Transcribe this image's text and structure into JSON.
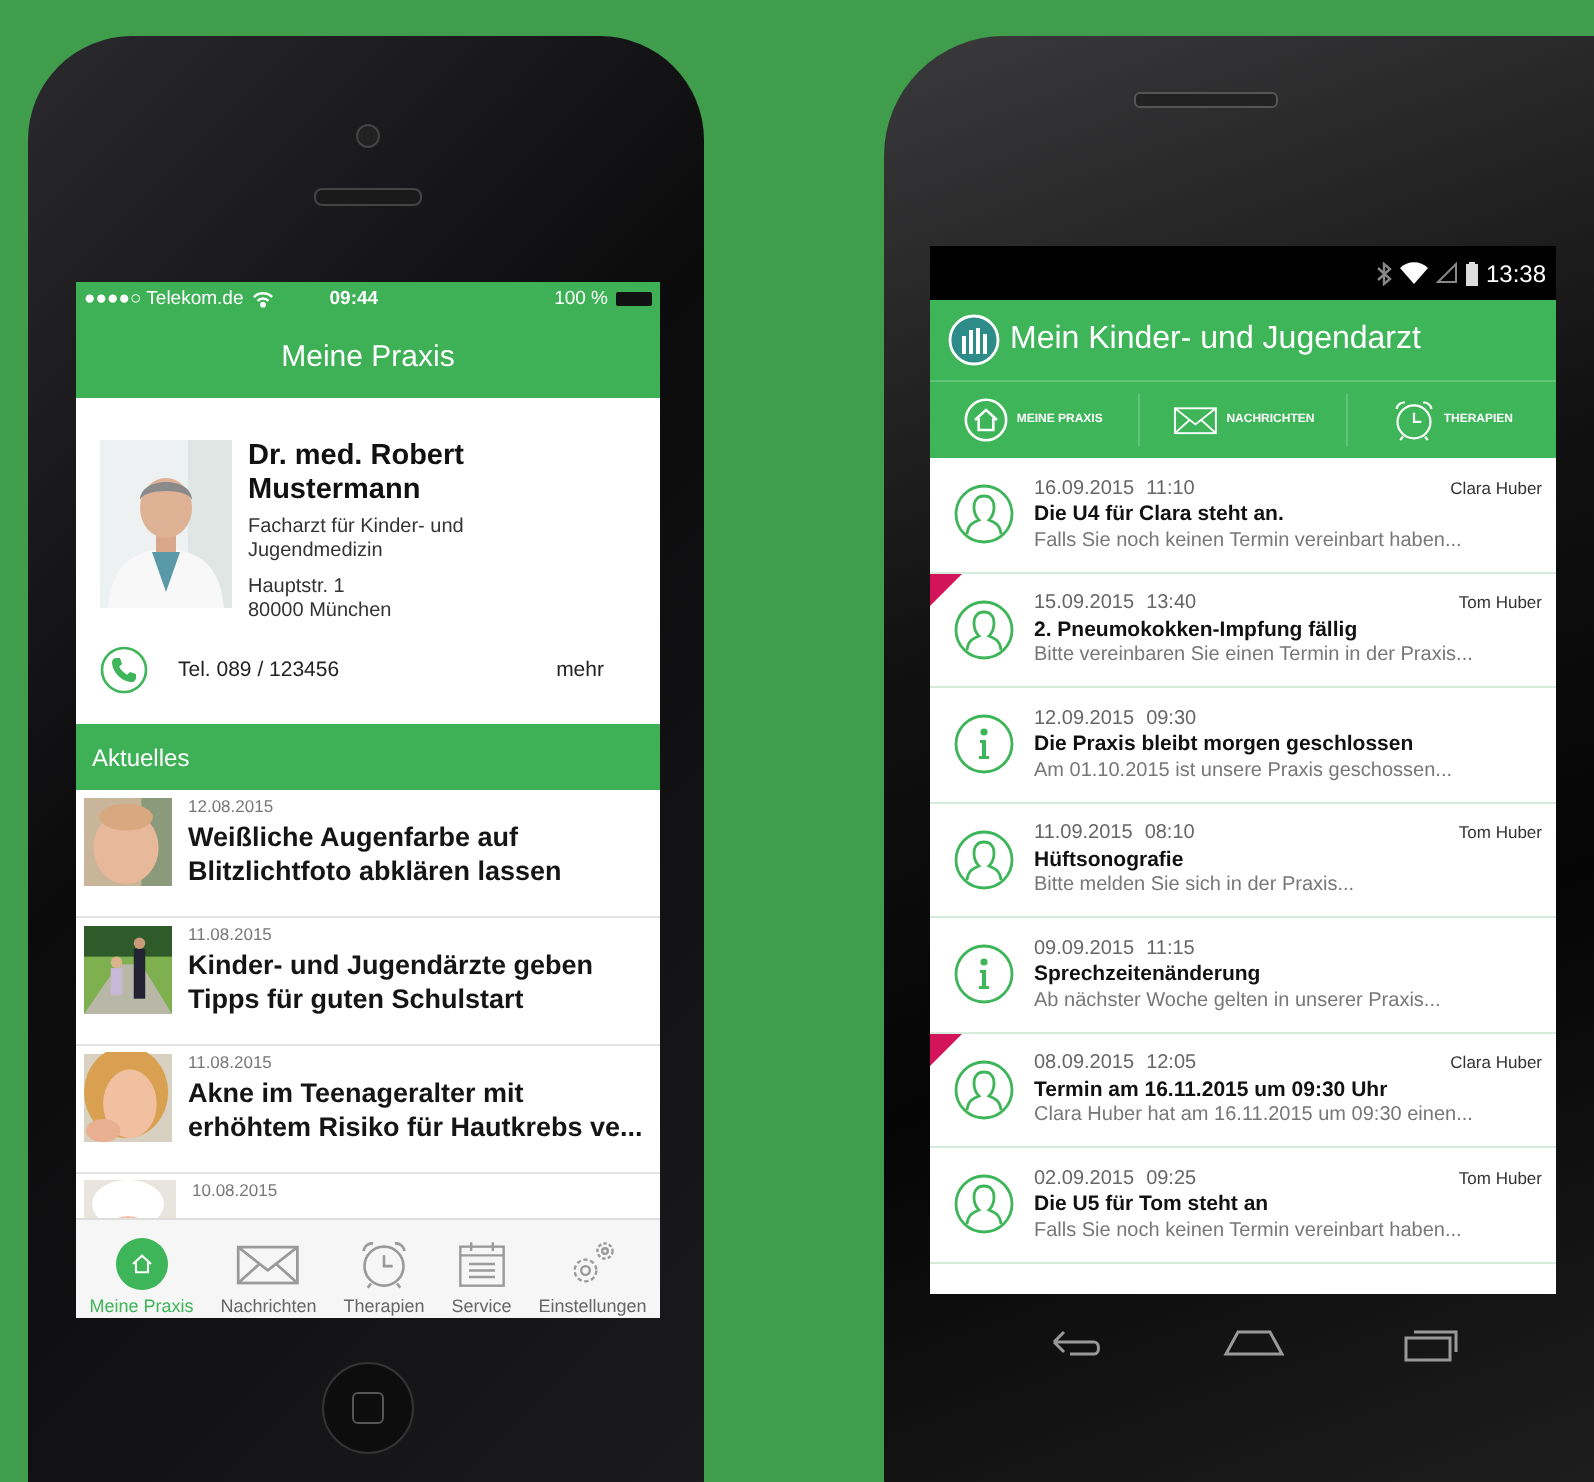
{
  "iphone": {
    "status": {
      "carrier": "●●●●○ Telekom.de",
      "time": "09:44",
      "battery": "100 %"
    },
    "title": "Meine Praxis",
    "doctor": {
      "name": "Dr. med. Robert Mustermann",
      "specialty": "Facharzt für Kinder- und Jugendmedizin",
      "street": "Hauptstr. 1",
      "city": "80000 München",
      "phone": "Tel. 089 / 123456",
      "more": "mehr"
    },
    "news_header": "Aktuelles",
    "news": [
      {
        "date": "12.08.2015",
        "title": "Weißliche Augenfarbe auf Blitzlichtfoto abklären lassen"
      },
      {
        "date": "11.08.2015",
        "title": "Kinder- und Jugendärzte geben Tipps für guten Schulstart"
      },
      {
        "date": "11.08.2015",
        "title": "Akne im Teenageralter mit erhöhtem Risiko für Hautkrebs ve..."
      },
      {
        "date": "10.08.2015"
      }
    ],
    "tabs": [
      {
        "label": "Meine Praxis",
        "selected": true
      },
      {
        "label": "Nachrichten",
        "selected": false
      },
      {
        "label": "Therapien",
        "selected": false
      },
      {
        "label": "Service",
        "selected": false
      },
      {
        "label": "Einstellungen",
        "selected": false
      }
    ]
  },
  "android": {
    "status": {
      "time": "13:38"
    },
    "title": "Mein Kinder- und Jugendarzt",
    "tabs": [
      {
        "label": "MEINE PRAXIS"
      },
      {
        "label": "NACHRICHTEN"
      },
      {
        "label": "THERAPIEN"
      }
    ],
    "messages": [
      {
        "kind": "person",
        "flagged": false,
        "date": "16.09.2015",
        "time": "11:10",
        "child": "Clara Huber",
        "title": "Die U4 für Clara steht an.",
        "preview": "Falls Sie noch keinen Termin vereinbart haben..."
      },
      {
        "kind": "person",
        "flagged": true,
        "date": "15.09.2015",
        "time": "13:40",
        "child": "Tom Huber",
        "title": "2. Pneumokokken-Impfung fällig",
        "preview": "Bitte vereinbaren Sie einen Termin in der Praxis..."
      },
      {
        "kind": "info",
        "flagged": false,
        "date": "12.09.2015",
        "time": "09:30",
        "title": "Die Praxis bleibt morgen geschlossen",
        "preview": "Am 01.10.2015 ist unsere Praxis geschossen..."
      },
      {
        "kind": "person",
        "flagged": false,
        "date": "11.09.2015",
        "time": "08:10",
        "child": "Tom Huber",
        "title": "Hüftsonografie",
        "preview": "Bitte melden Sie sich in der Praxis..."
      },
      {
        "kind": "info",
        "flagged": false,
        "date": "09.09.2015",
        "time": "11:15",
        "title": "Sprechzeitenänderung",
        "preview": "Ab nächster Woche gelten in unserer Praxis..."
      },
      {
        "kind": "person",
        "flagged": true,
        "date": "08.09.2015",
        "time": "12:05",
        "child": "Clara Huber",
        "title": "Termin am 16.11.2015 um 09:30 Uhr",
        "preview": "Clara Huber hat am 16.11.2015 um 09:30 einen..."
      },
      {
        "kind": "person",
        "flagged": false,
        "date": "02.09.2015",
        "time": "09:25",
        "child": "Tom Huber",
        "title": "Die U5 für Tom steht an",
        "preview": "Falls Sie noch keinen Termin vereinbart haben..."
      }
    ]
  }
}
